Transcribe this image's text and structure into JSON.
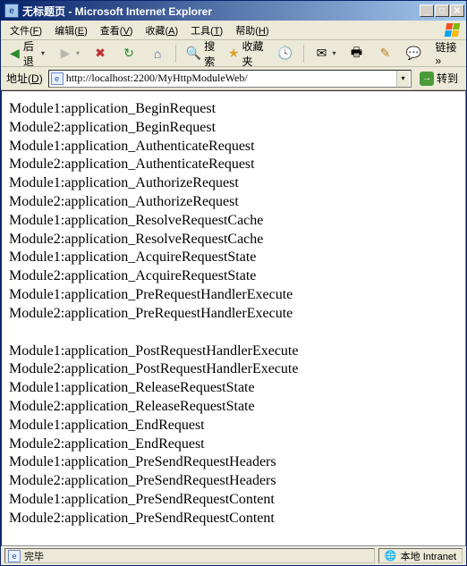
{
  "window": {
    "title": "无标题页 - Microsoft Internet Explorer"
  },
  "menu": {
    "file": {
      "label": "文件",
      "key": "F"
    },
    "edit": {
      "label": "编辑",
      "key": "E"
    },
    "view": {
      "label": "查看",
      "key": "V"
    },
    "fav": {
      "label": "收藏",
      "key": "A"
    },
    "tools": {
      "label": "工具",
      "key": "T"
    },
    "help": {
      "label": "帮助",
      "key": "H"
    }
  },
  "toolbar": {
    "back": "后退",
    "search": "搜索",
    "favorites": "收藏夹",
    "links": "链接"
  },
  "address": {
    "label": "地址",
    "key": "D",
    "url": "http://localhost:2200/MyHttpModuleWeb/",
    "go": "转到"
  },
  "content": {
    "block1": [
      "Module1:application_BeginRequest",
      "Module2:application_BeginRequest",
      "Module1:application_AuthenticateRequest",
      "Module2:application_AuthenticateRequest",
      "Module1:application_AuthorizeRequest",
      "Module2:application_AuthorizeRequest",
      "Module1:application_ResolveRequestCache",
      "Module2:application_ResolveRequestCache",
      "Module1:application_AcquireRequestState",
      "Module2:application_AcquireRequestState",
      "Module1:application_PreRequestHandlerExecute",
      "Module2:application_PreRequestHandlerExecute"
    ],
    "block2": [
      "Module1:application_PostRequestHandlerExecute",
      "Module2:application_PostRequestHandlerExecute",
      "Module1:application_ReleaseRequestState",
      "Module2:application_ReleaseRequestState",
      "Module1:application_EndRequest",
      "Module2:application_EndRequest",
      "Module1:application_PreSendRequestHeaders",
      "Module2:application_PreSendRequestHeaders",
      "Module1:application_PreSendRequestContent",
      "Module2:application_PreSendRequestContent"
    ]
  },
  "status": {
    "left": "完毕",
    "zone": "本地 Intranet"
  },
  "icons": {
    "back": "◀",
    "forward": "▶",
    "stop": "✖",
    "refresh": "↻",
    "home": "⌂",
    "search": "🔍",
    "star": "★",
    "history": "🕓",
    "mail": "✉",
    "print": "🖶",
    "edit": "✎",
    "chat": "💬",
    "go": "→",
    "globe": "🌐",
    "doc": "e",
    "chev": "»"
  }
}
